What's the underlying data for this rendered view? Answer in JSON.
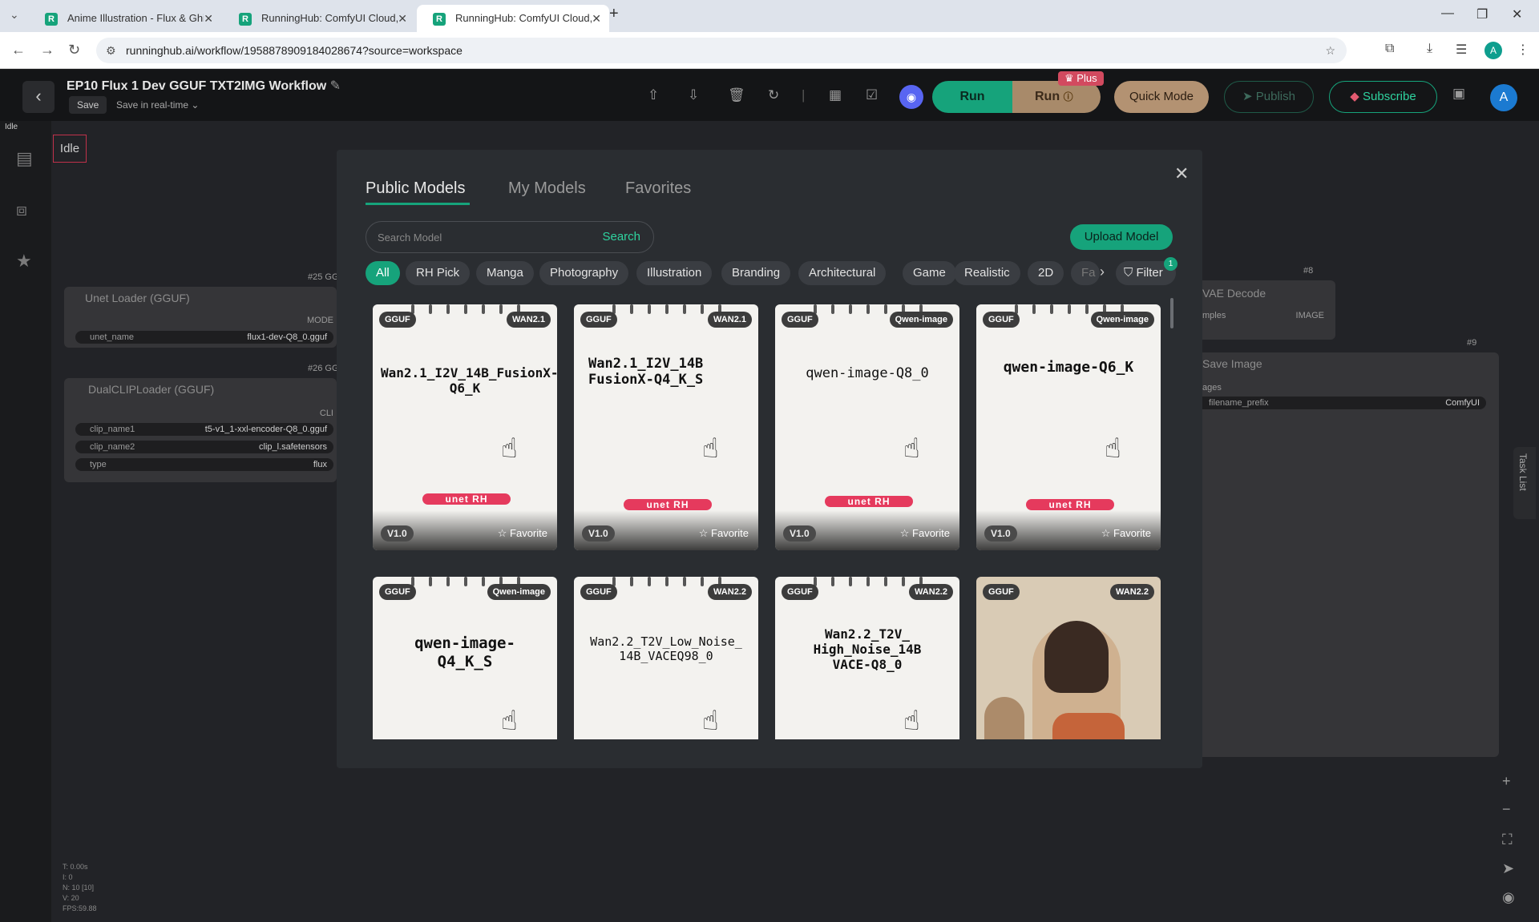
{
  "browser": {
    "tabs": [
      {
        "title": "Anime Illustration - Flux & Ghibli",
        "active": false
      },
      {
        "title": "RunningHub: ComfyUI Cloud, C",
        "active": false
      },
      {
        "title": "RunningHub: ComfyUI Cloud, C",
        "active": true
      }
    ],
    "url": "runninghub.ai/workflow/1958878909184028674?source=workspace",
    "profile_initial": "A"
  },
  "header": {
    "title": "EP10 Flux 1 Dev GGUF TXT2IMG Workflow",
    "save_label": "Save",
    "save_mode": "Save in real-time",
    "run_label": "Run",
    "run_plus_label": "Run",
    "plus_badge": "Plus",
    "quick_mode": "Quick Mode",
    "publish": "Publish",
    "subscribe": "Subscribe",
    "user_initial": "A"
  },
  "canvas": {
    "status_small": "Idle",
    "status_box": "Idle",
    "nodes": {
      "unet": {
        "tag": "#25 GG",
        "title": "Unet Loader (GGUF)",
        "output": "MODE",
        "rows": [
          {
            "k": "unet_name",
            "v": "flux1-dev-Q8_0.gguf"
          }
        ]
      },
      "clip": {
        "tag": "#26 GG",
        "title": "DualCLIPLoader (GGUF)",
        "output": "CLI",
        "rows": [
          {
            "k": "clip_name1",
            "v": "t5-v1_1-xxl-encoder-Q8_0.gguf"
          },
          {
            "k": "clip_name2",
            "v": "clip_l.safetensors"
          },
          {
            "k": "type",
            "v": "flux"
          }
        ]
      },
      "vae": {
        "tag": "#8",
        "title": "VAE Decode",
        "in": "mples",
        "out": "IMAGE"
      },
      "save": {
        "tag": "#9",
        "title": "Save Image",
        "in": "ages",
        "k": "filename_prefix",
        "v": "ComfyUI"
      }
    },
    "stats": [
      "T: 0.00s",
      "I: 0",
      "N: 10 [10]",
      "V: 20",
      "FPS:59.88"
    ],
    "task_list": "Task List"
  },
  "modal": {
    "tabs": [
      "Public Models",
      "My Models",
      "Favorites"
    ],
    "active_tab": "Public Models",
    "search_placeholder": "Search Model",
    "search_button": "Search",
    "upload_button": "Upload Model",
    "categories": [
      "All",
      "RH Pick",
      "Manga",
      "Photography",
      "Illustration",
      "Branding",
      "Architectural",
      "Game",
      "Realistic",
      "2D",
      "Fa"
    ],
    "active_category": "All",
    "filter_label": "Filter",
    "filter_count": "1",
    "models": [
      {
        "format": "GGUF",
        "base": "WAN2.1",
        "name": "Wan2.1_I2V_14B_FusionX-Q6_K",
        "tag": "unet RH",
        "version": "V1.0",
        "favorite": "Favorite"
      },
      {
        "format": "GGUF",
        "base": "WAN2.1",
        "name": "Wan2.1_I2V_14B FusionX-Q4_K_S",
        "tag": "unet RH",
        "version": "V1.0",
        "favorite": "Favorite"
      },
      {
        "format": "GGUF",
        "base": "Qwen-image",
        "name": "qwen-image-Q8_0",
        "tag": "unet RH",
        "version": "V1.0",
        "favorite": "Favorite"
      },
      {
        "format": "GGUF",
        "base": "Qwen-image",
        "name": "qwen-image-Q6_K",
        "tag": "unet RH",
        "version": "V1.0",
        "favorite": "Favorite"
      },
      {
        "format": "GGUF",
        "base": "Qwen-image",
        "name": "qwen-image-Q4_K_S"
      },
      {
        "format": "GGUF",
        "base": "WAN2.2",
        "name": "Wan2.2_T2V_Low_Noise_14B_VACEQ98_0"
      },
      {
        "format": "GGUF",
        "base": "WAN2.2",
        "name": "Wan2.2_T2V_ High_Noise_14B VACE-Q8_0"
      },
      {
        "format": "GGUF",
        "base": "WAN2.2",
        "name": ""
      }
    ]
  }
}
